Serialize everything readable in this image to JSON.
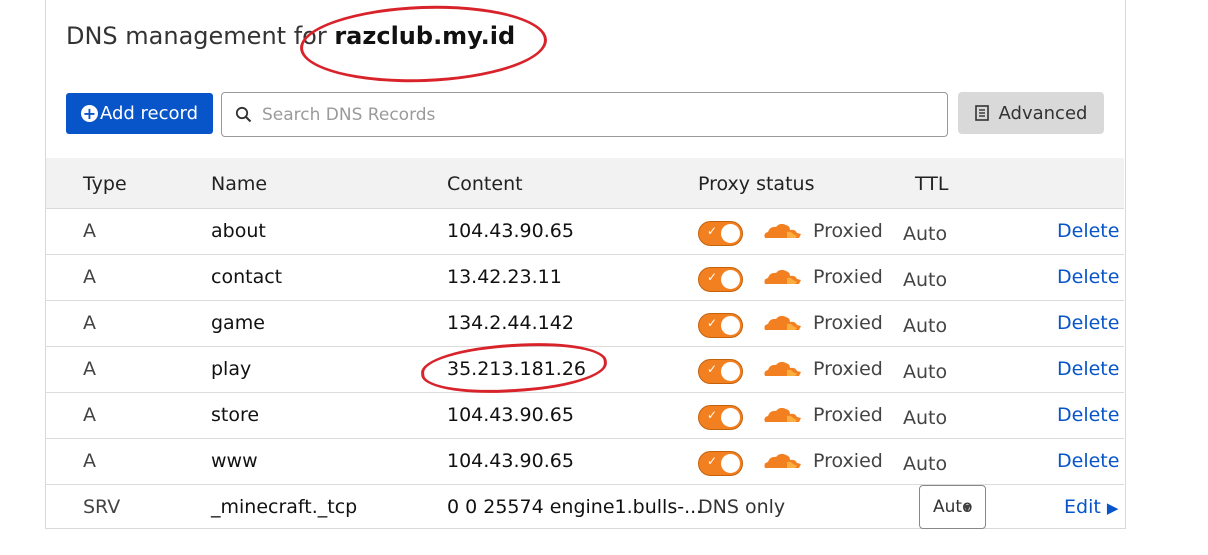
{
  "header": {
    "title_prefix": "DNS management for",
    "domain": "razclub.my.id"
  },
  "toolbar": {
    "add_record_label": "Add record",
    "search_placeholder": "Search DNS Records",
    "advanced_label": "Advanced"
  },
  "table": {
    "columns": [
      "Type",
      "Name",
      "Content",
      "Proxy status",
      "TTL"
    ],
    "rows": [
      {
        "type": "A",
        "name": "about",
        "content": "104.43.90.65",
        "proxy": "Proxied",
        "ttl": "Auto",
        "action": "Delete"
      },
      {
        "type": "A",
        "name": "contact",
        "content": "13.42.23.11",
        "proxy": "Proxied",
        "ttl": "Auto",
        "action": "Delete"
      },
      {
        "type": "A",
        "name": "game",
        "content": "134.2.44.142",
        "proxy": "Proxied",
        "ttl": "Auto",
        "action": "Delete"
      },
      {
        "type": "A",
        "name": "play",
        "content": "35.213.181.26",
        "proxy": "Proxied",
        "ttl": "Auto",
        "action": "Delete"
      },
      {
        "type": "A",
        "name": "store",
        "content": "104.43.90.65",
        "proxy": "Proxied",
        "ttl": "Auto",
        "action": "Delete"
      },
      {
        "type": "A",
        "name": "www",
        "content": "104.43.90.65",
        "proxy": "Proxied",
        "ttl": "Auto",
        "action": "Delete"
      }
    ],
    "srv_row": {
      "type": "SRV",
      "name": "_minecraft._tcp",
      "content": "0 0 25574 engine1.bulls-...",
      "proxy": "DNS only",
      "ttl": "Auto",
      "action": "Edit"
    }
  },
  "colors": {
    "accent_blue": "#0755c9",
    "proxy_orange": "#f38020",
    "annotation_red": "#d8232a"
  },
  "icons": {
    "add": "plus-circle-icon",
    "search": "search-icon",
    "advanced": "document-icon",
    "proxied": "cloud-icon",
    "edit_caret": "caret-right-icon"
  }
}
